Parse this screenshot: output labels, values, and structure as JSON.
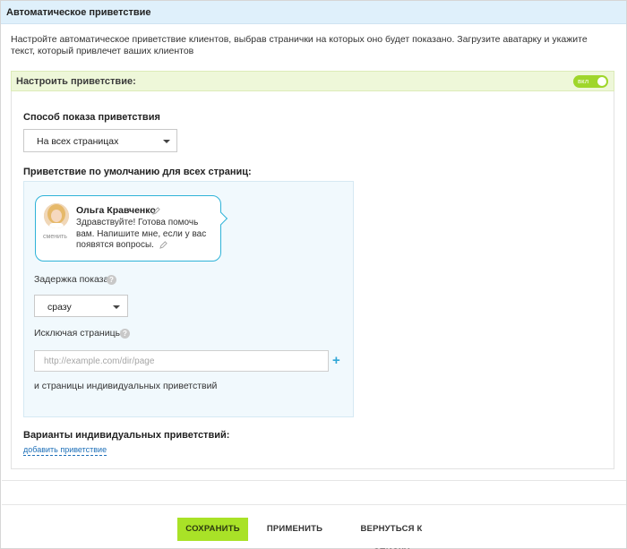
{
  "title": "Автоматическое приветствие",
  "intro": "Настройте автоматическое приветствие клиентов, выбрав странички на которых оно будет показано. Загрузите аватарку и укажите текст, который привлечет ваших клиентов",
  "toggle": {
    "label": "Настроить приветствие:",
    "state_label": "вкл",
    "enabled": true
  },
  "display_method": {
    "heading": "Способ показа приветствия",
    "selected": "На всех страницах"
  },
  "default_greeting": {
    "heading": "Приветствие по умолчанию для всех страниц:",
    "operator_name": "Ольга Кравченко",
    "avatar_change": "сменить",
    "message": "Здравствуйте! Готова помочь вам. Напишите мне, если у вас появятся вопросы."
  },
  "delay": {
    "label": "Задержка показа:",
    "selected": "сразу",
    "help": "?"
  },
  "exclude": {
    "label": "Исключая страницы:",
    "help": "?",
    "placeholder": "http://example.com/dir/page",
    "value": "",
    "add_icon": "+",
    "note": "и страницы индивидуальных приветствий"
  },
  "variants": {
    "heading": "Варианты индивидуальных приветствий:",
    "add_link": "добавить приветствие"
  },
  "footer": {
    "save": "СОХРАНИТЬ",
    "apply": "ПРИМЕНИТЬ",
    "back": "ВЕРНУТЬСЯ К СПИСКУ"
  },
  "colors": {
    "accent_green": "#a9e227",
    "bubble_border": "#2fb3d8",
    "link": "#1d6fb8",
    "header_bg": "#dff0fb"
  }
}
